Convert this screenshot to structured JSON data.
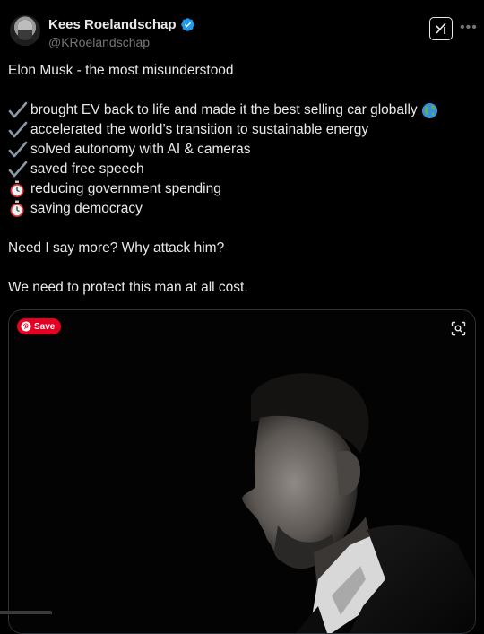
{
  "author": {
    "name": "Kees Roelandschap",
    "handle": "@KRoelandschap"
  },
  "tweet": {
    "title": "Elon Musk - the most misunderstood",
    "items": [
      {
        "icon": "check-mark-icon",
        "text": "brought EV back to life and made it the best selling car globally"
      },
      {
        "icon": "check-mark-icon",
        "text": "accelerated the world’s transition to sustainable energy"
      },
      {
        "icon": "check-mark-icon",
        "text": "solved autonomy with AI & cameras"
      },
      {
        "icon": "check-mark-icon",
        "text": "saved free speech"
      },
      {
        "icon": "stopwatch-icon",
        "text": "reducing government spending"
      },
      {
        "icon": "stopwatch-icon",
        "text": "saving democracy"
      }
    ],
    "question": "Need I say more? Why attack him?",
    "closing": "We need to protect this man at all cost."
  },
  "media": {
    "save_label": "Save"
  },
  "colors": {
    "background": "#000000",
    "text": "#e7e9ea",
    "muted": "#71767b",
    "verified": "#1d9bf0",
    "pinterest": "#e60023",
    "border": "#2f3336"
  }
}
